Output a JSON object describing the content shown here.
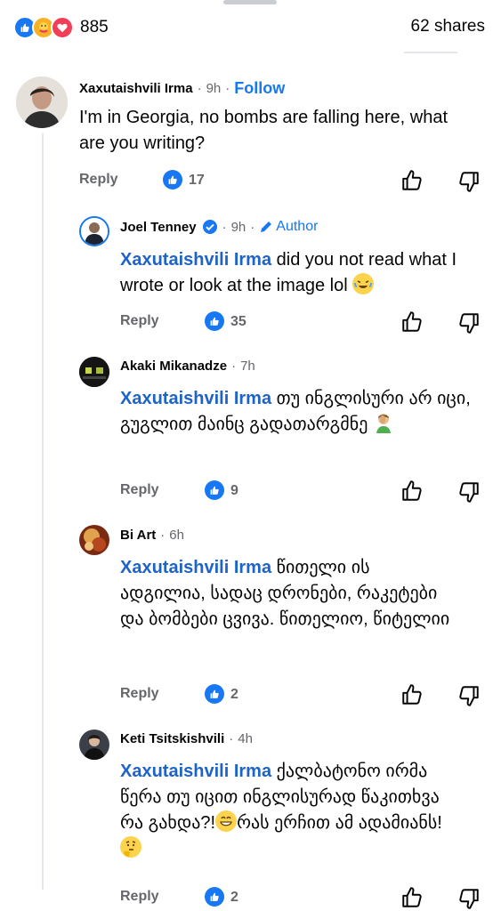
{
  "summary": {
    "reaction_count": "885",
    "shares": "62 shares",
    "reaction_icons": [
      "like-icon",
      "care-icon",
      "love-icon"
    ]
  },
  "colors": {
    "accent": "#1877f2",
    "mention": "#1d63c9",
    "meta": "#65676b"
  },
  "comments": [
    {
      "author": "Xaxutaishvili Irma",
      "time": "9h",
      "follow_label": "Follow",
      "text": "I'm in Georgia, no bombs are falling here, what are you writing?",
      "reply_label": "Reply",
      "like_count": "17"
    },
    {
      "author": "Joel Tenney",
      "time": "9h",
      "author_tag": "Author",
      "mention": "Xaxutaishvili Irma",
      "text": "did you not read what I wrote or look at the image lol",
      "reply_label": "Reply",
      "like_count": "35"
    },
    {
      "author": "Akaki Mikanadze",
      "time": "7h",
      "mention": "Xaxutaishvili Irma",
      "text": "თუ ინგლისური არ იცი, გუგლით მაინც გადათარგმნე",
      "reply_label": "Reply",
      "like_count": "9"
    },
    {
      "author": "Bi Art",
      "time": "6h",
      "mention": "Xaxutaishvili Irma",
      "text": "წითელი ის ადგილია, სადაც დრონები, რაკეტები და ბომბები ცვივა. წითელიო, წიტელიი",
      "reply_label": "Reply",
      "like_count": "2"
    },
    {
      "author": "Keti Tsitskishvili",
      "time": "4h",
      "mention": "Xaxutaishvili Irma",
      "text": "ქალბატონო ირმა წერა თუ იცით ინგლისურად წაკითხვა რა გახდა?!",
      "text_tail": "რას ერჩით ამ ადამიანს!",
      "reply_label": "Reply",
      "like_count": "2"
    }
  ]
}
